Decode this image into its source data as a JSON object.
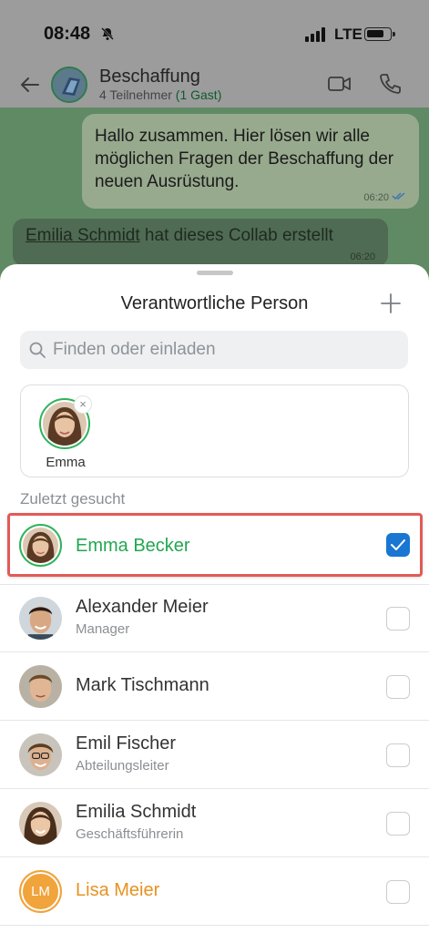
{
  "status_bar": {
    "time": "08:48",
    "network": "LTE"
  },
  "chat_header": {
    "title": "Beschaffung",
    "participants": "4 Teilnehmer",
    "guests": "(1 Gast)"
  },
  "messages": {
    "outgoing_text": "Hallo zusammen. Hier lösen wir alle möglichen Fragen der Beschaffung der neuen Ausrüstung.",
    "outgoing_time": "06:20",
    "system_author": "Emilia Schmidt",
    "system_text": " hat dieses Collab erstellt",
    "system_time": "06:20"
  },
  "sheet": {
    "title": "Verantwortliche Person",
    "search_placeholder": "Finden oder einladen",
    "selected": [
      {
        "name": "Emma"
      }
    ],
    "section_label": "Zuletzt gesucht",
    "people": [
      {
        "name": "Emma Becker",
        "role": "",
        "checked": true
      },
      {
        "name": "Alexander Meier",
        "role": "Manager",
        "checked": false
      },
      {
        "name": "Mark Tischmann",
        "role": "",
        "checked": false
      },
      {
        "name": "Emil Fischer",
        "role": "Abteilungsleiter",
        "checked": false
      },
      {
        "name": "Emilia Schmidt",
        "role": "Geschäftsführerin",
        "checked": false
      },
      {
        "name": "Lisa Meier",
        "role": "",
        "initials": "LM",
        "checked": false
      }
    ]
  },
  "colors": {
    "accent_green": "#22a650",
    "checkbox_blue": "#1976d2",
    "highlight_red": "#e25a57",
    "orange": "#e79220"
  }
}
